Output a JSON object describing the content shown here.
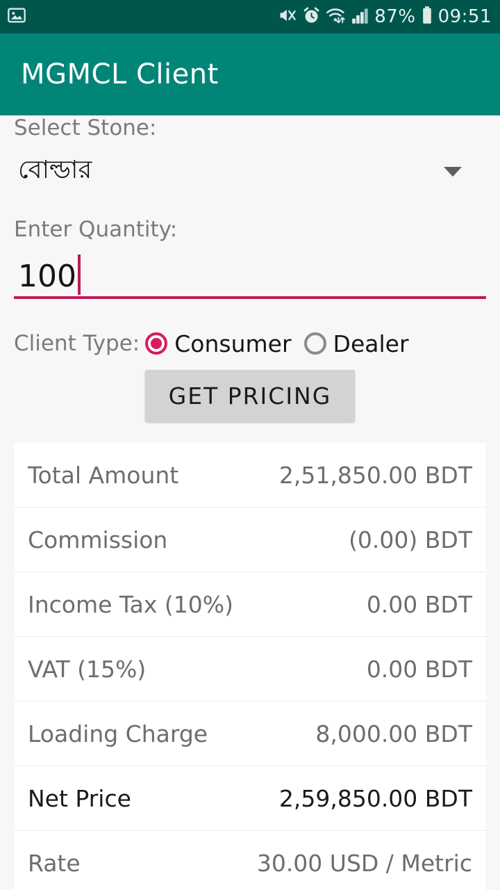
{
  "statusbar": {
    "background": "#00564b",
    "left_icons": [
      {
        "name": "gallery-notification-icon",
        "glyph": "image"
      }
    ],
    "right_icons": [
      {
        "name": "mute-vibrate-icon",
        "glyph": "speaker-mute"
      },
      {
        "name": "alarm-clock-icon",
        "glyph": "alarm"
      },
      {
        "name": "wifi-transfer-icon",
        "glyph": "wifi"
      },
      {
        "name": "cellular-signal-icon",
        "glyph": "bars"
      }
    ],
    "battery_percent": "87%",
    "battery_icon": "battery-icon",
    "clock": "09:51"
  },
  "appbar": {
    "title": "MGMCL Client",
    "background": "#008577",
    "text_color": "#ffffff"
  },
  "form": {
    "stone": {
      "label": "Select Stone:",
      "selected": "বোল্ডার",
      "dropdown_icon": "chevron-down-icon"
    },
    "quantity": {
      "label": "Enter Quantity:",
      "value": "100",
      "placeholder": "",
      "accent_color": "#c2185b"
    },
    "client_type": {
      "label": "Client Type:",
      "options": [
        {
          "label": "Consumer",
          "selected": true
        },
        {
          "label": "Dealer",
          "selected": false
        }
      ],
      "accent_color": "#d81b60"
    },
    "submit": {
      "label": "GET PRICING",
      "background": "#d3d3d3"
    }
  },
  "results": {
    "rows": [
      {
        "label": "Total Amount",
        "value": "2,51,850.00 BDT",
        "emphasis": false
      },
      {
        "label": "Commission",
        "value": "(0.00) BDT",
        "emphasis": false
      },
      {
        "label": "Income Tax (10%)",
        "value": "0.00 BDT",
        "emphasis": false
      },
      {
        "label": "VAT (15%)",
        "value": "0.00 BDT",
        "emphasis": false
      },
      {
        "label": "Loading Charge",
        "value": "8,000.00 BDT",
        "emphasis": false
      },
      {
        "label": "Net Price",
        "value": "2,59,850.00 BDT",
        "emphasis": true
      },
      {
        "label": "Rate",
        "value": "30.00 USD / Metric",
        "emphasis": false
      }
    ]
  }
}
